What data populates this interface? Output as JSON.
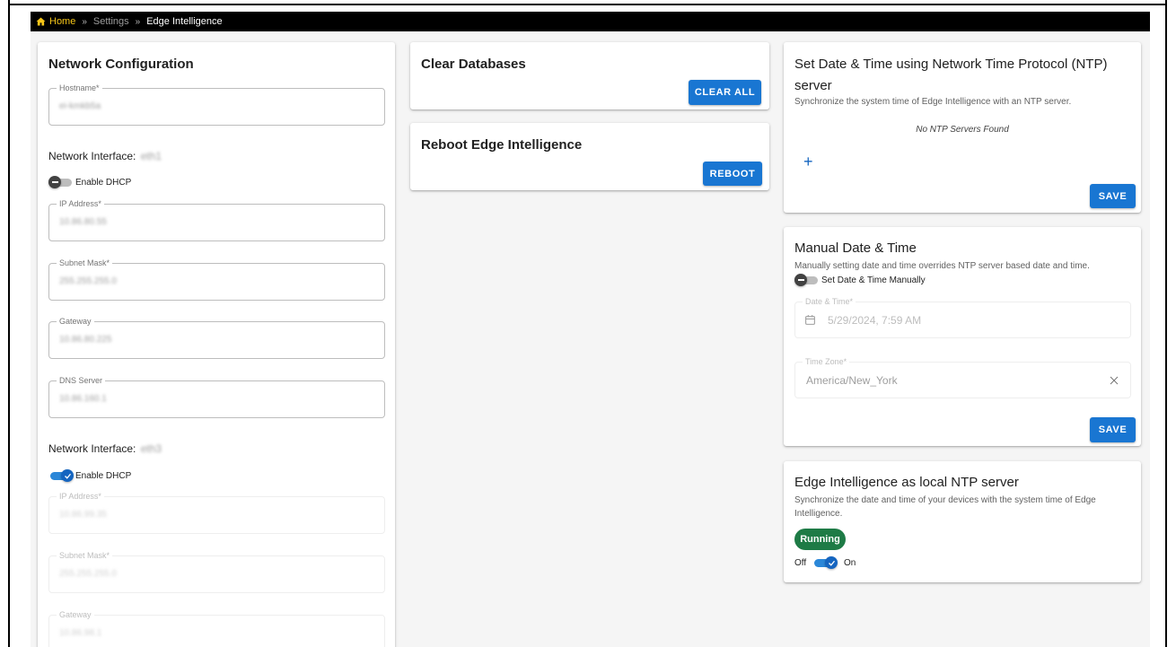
{
  "breadcrumb": {
    "home": "Home",
    "separator": "»",
    "settings": "Settings",
    "current": "Edge Intelligence"
  },
  "network": {
    "title": "Network Configuration",
    "hostname": {
      "label": "Hostname*",
      "value": "ei-kmkb5a"
    },
    "interface_label": "Network Interface:",
    "interfaces": [
      {
        "name": "eth1",
        "dhcp_label": "Enable DHCP",
        "dhcp_enabled": false,
        "ip": {
          "label": "IP Address*",
          "value": "10.86.80.55"
        },
        "subnet": {
          "label": "Subnet Mask*",
          "value": "255.255.255.0"
        },
        "gateway": {
          "label": "Gateway",
          "value": "10.86.80.225"
        },
        "dns": {
          "label": "DNS Server",
          "value": "10.86.160.1"
        }
      },
      {
        "name": "eth3",
        "dhcp_label": "Enable DHCP",
        "dhcp_enabled": true,
        "ip": {
          "label": "IP Address*",
          "value": "10.86.99.35"
        },
        "subnet": {
          "label": "Subnet Mask*",
          "value": "255.255.255.0"
        },
        "gateway": {
          "label": "Gateway",
          "value": "10.86.98.1"
        }
      }
    ]
  },
  "clear_db": {
    "title": "Clear Databases",
    "button": "CLEAR ALL"
  },
  "reboot": {
    "title": "Reboot Edge Intelligence",
    "button": "REBOOT"
  },
  "ntp": {
    "title_line1": "Set Date & Time using Network Time Protocol (NTP)",
    "title_line2": "server",
    "subtitle": "Synchronize the system time of Edge Intelligence with an NTP server.",
    "empty": "No NTP Servers Found",
    "add_symbol": "+",
    "button": "SAVE"
  },
  "manual": {
    "title": "Manual Date & Time",
    "subtitle": "Manually setting date and time overrides NTP server based date and time.",
    "toggle_label": "Set Date & Time Manually",
    "toggle_on": false,
    "datetime": {
      "label": "Date & Time*",
      "value": "5/29/2024, 7:59 AM"
    },
    "timezone": {
      "label": "Time Zone*",
      "value": "America/New_York"
    },
    "button": "SAVE"
  },
  "local_ntp": {
    "title": "Edge Intelligence as local NTP server",
    "subtitle": "Synchronize the date and time of your devices with the system time of Edge Intelligence.",
    "status": "Running",
    "off_label": "Off",
    "on_label": "On",
    "enabled": true
  },
  "colors": {
    "primary": "#1976d2",
    "status_running": "#1e7b46",
    "breadcrumb_home": "#f5c518"
  }
}
